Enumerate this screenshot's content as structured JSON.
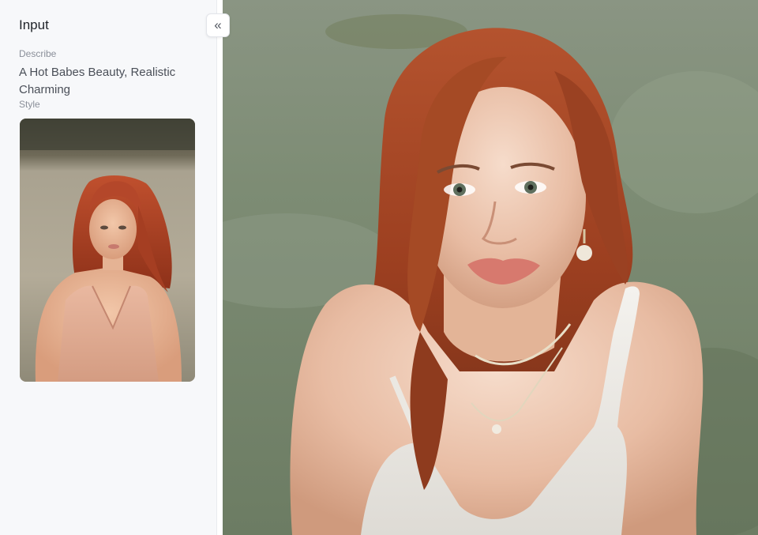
{
  "sidebar": {
    "title": "Input",
    "describe_label": "Describe",
    "describe_text": "A Hot Babes Beauty, Realistic Charming",
    "style_label": "Style"
  },
  "collapse_button": {
    "icon": "double-chevron-left-icon",
    "glyph": "«"
  },
  "style_thumbnail": {
    "subject": "red-haired woman in pink dress seated outdoors"
  },
  "result_image": {
    "subject": "red-haired woman in white top on grass"
  },
  "colors": {
    "sidebar_bg": "#f7f8fa",
    "text_primary": "#1f2329",
    "text_secondary": "#8a8f99"
  }
}
